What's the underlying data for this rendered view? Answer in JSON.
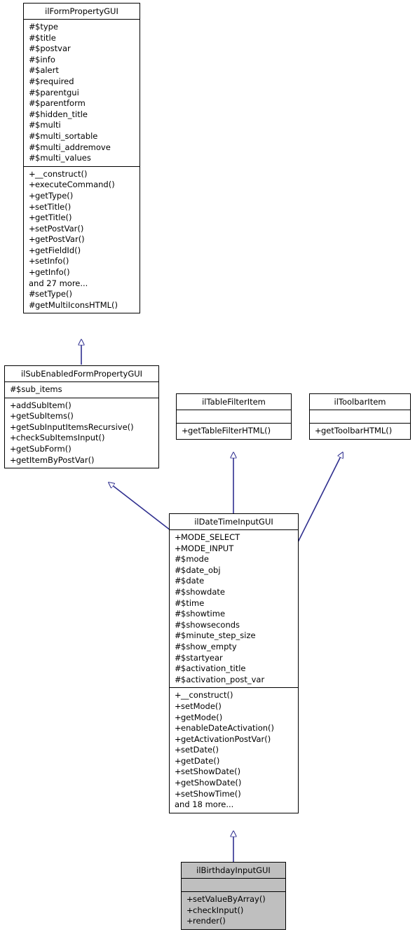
{
  "diagram": {
    "type": "uml-class-diagram",
    "title": "ilBirthdayInputGUI inheritance diagram",
    "background_color": "#ffffff",
    "edge_color": "#2f2f8f",
    "border_color": "#000000",
    "highlight_fill": "#bfbfbf"
  },
  "nodes": [
    {
      "id": "ilFormPropertyGUI",
      "name": "ilFormPropertyGUI",
      "highlighted": false,
      "attributes": [
        {
          "vis": "#",
          "label": "$type"
        },
        {
          "vis": "#",
          "label": "$title"
        },
        {
          "vis": "#",
          "label": "$postvar"
        },
        {
          "vis": "#",
          "label": "$info"
        },
        {
          "vis": "#",
          "label": "$alert"
        },
        {
          "vis": "#",
          "label": "$required"
        },
        {
          "vis": "#",
          "label": "$parentgui"
        },
        {
          "vis": "#",
          "label": "$parentform"
        },
        {
          "vis": "#",
          "label": "$hidden_title"
        },
        {
          "vis": "#",
          "label": "$multi"
        },
        {
          "vis": "#",
          "label": "$multi_sortable"
        },
        {
          "vis": "#",
          "label": "$multi_addremove"
        },
        {
          "vis": "#",
          "label": "$multi_values"
        }
      ],
      "methods": [
        {
          "vis": "+",
          "label": "__construct()"
        },
        {
          "vis": "+",
          "label": "executeCommand()"
        },
        {
          "vis": "+",
          "label": "getType()"
        },
        {
          "vis": "+",
          "label": "setTitle()"
        },
        {
          "vis": "+",
          "label": "getTitle()"
        },
        {
          "vis": "+",
          "label": "setPostVar()"
        },
        {
          "vis": "+",
          "label": "getPostVar()"
        },
        {
          "vis": "+",
          "label": "getFieldId()"
        },
        {
          "vis": "+",
          "label": "setInfo()"
        },
        {
          "vis": "+",
          "label": "getInfo()"
        },
        {
          "vis": "",
          "label": "and 27 more..."
        },
        {
          "vis": "#",
          "label": "setType()"
        },
        {
          "vis": "#",
          "label": "getMultiIconsHTML()"
        }
      ]
    },
    {
      "id": "ilSubEnabledFormPropertyGUI",
      "name": "ilSubEnabledFormPropertyGUI",
      "highlighted": false,
      "attributes": [
        {
          "vis": "#",
          "label": "$sub_items"
        }
      ],
      "methods": [
        {
          "vis": "+",
          "label": "addSubItem()"
        },
        {
          "vis": "+",
          "label": "getSubItems()"
        },
        {
          "vis": "+",
          "label": "getSubInputItemsRecursive()"
        },
        {
          "vis": "+",
          "label": "checkSubItemsInput()"
        },
        {
          "vis": "+",
          "label": "getSubForm()"
        },
        {
          "vis": "+",
          "label": "getItemByPostVar()"
        }
      ]
    },
    {
      "id": "ilTableFilterItem",
      "name": "ilTableFilterItem",
      "highlighted": false,
      "attributes": [],
      "methods": [
        {
          "vis": "+",
          "label": "getTableFilterHTML()"
        }
      ]
    },
    {
      "id": "ilToolbarItem",
      "name": "ilToolbarItem",
      "highlighted": false,
      "attributes": [],
      "methods": [
        {
          "vis": "+",
          "label": "getToolbarHTML()"
        }
      ]
    },
    {
      "id": "ilDateTimeInputGUI",
      "name": "ilDateTimeInputGUI",
      "highlighted": false,
      "attributes": [
        {
          "vis": "+",
          "label": "MODE_SELECT"
        },
        {
          "vis": "+",
          "label": "MODE_INPUT"
        },
        {
          "vis": "#",
          "label": "$mode"
        },
        {
          "vis": "#",
          "label": "$date_obj"
        },
        {
          "vis": "#",
          "label": "$date"
        },
        {
          "vis": "#",
          "label": "$showdate"
        },
        {
          "vis": "#",
          "label": "$time"
        },
        {
          "vis": "#",
          "label": "$showtime"
        },
        {
          "vis": "#",
          "label": "$showseconds"
        },
        {
          "vis": "#",
          "label": "$minute_step_size"
        },
        {
          "vis": "#",
          "label": "$show_empty"
        },
        {
          "vis": "#",
          "label": "$startyear"
        },
        {
          "vis": "#",
          "label": "$activation_title"
        },
        {
          "vis": "#",
          "label": "$activation_post_var"
        }
      ],
      "methods": [
        {
          "vis": "+",
          "label": "__construct()"
        },
        {
          "vis": "+",
          "label": "setMode()"
        },
        {
          "vis": "+",
          "label": "getMode()"
        },
        {
          "vis": "+",
          "label": "enableDateActivation()"
        },
        {
          "vis": "+",
          "label": "getActivationPostVar()"
        },
        {
          "vis": "+",
          "label": "setDate()"
        },
        {
          "vis": "+",
          "label": "getDate()"
        },
        {
          "vis": "+",
          "label": "setShowDate()"
        },
        {
          "vis": "+",
          "label": "getShowDate()"
        },
        {
          "vis": "+",
          "label": "setShowTime()"
        },
        {
          "vis": "",
          "label": "and 18 more..."
        }
      ]
    },
    {
      "id": "ilBirthdayInputGUI",
      "name": "ilBirthdayInputGUI",
      "highlighted": true,
      "attributes": [],
      "methods": [
        {
          "vis": "+",
          "label": "setValueByArray()"
        },
        {
          "vis": "+",
          "label": "checkInput()"
        },
        {
          "vis": "+",
          "label": "render()"
        }
      ]
    }
  ],
  "edges": [
    {
      "from": "ilSubEnabledFormPropertyGUI",
      "to": "ilFormPropertyGUI",
      "kind": "generalization"
    },
    {
      "from": "ilDateTimeInputGUI",
      "to": "ilSubEnabledFormPropertyGUI",
      "kind": "generalization"
    },
    {
      "from": "ilDateTimeInputGUI",
      "to": "ilTableFilterItem",
      "kind": "generalization"
    },
    {
      "from": "ilDateTimeInputGUI",
      "to": "ilToolbarItem",
      "kind": "generalization"
    },
    {
      "from": "ilBirthdayInputGUI",
      "to": "ilDateTimeInputGUI",
      "kind": "generalization"
    }
  ]
}
